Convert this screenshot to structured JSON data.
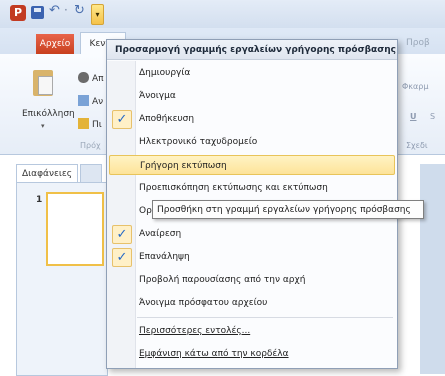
{
  "window": {
    "app_icon_letter": "P",
    "tabs": {
      "file": "Αρχείο",
      "home": "Κεντρ",
      "faint_right": "Προβ"
    },
    "ribbon": {
      "paste_label": "Επικόλληση",
      "small_cmds": [
        "Απ",
        "Αν",
        "Πι"
      ],
      "group_label": "Πρόχ",
      "right_snippets": [
        "Φκαρμ",
        "U",
        "S",
        "Σχεδι"
      ]
    },
    "pane": {
      "tab_slides": "Διαφάνειες",
      "slide_number": "1"
    }
  },
  "menu": {
    "title": "Προσαρμογή γραμμής εργαλείων γρήγορης πρόσβασης",
    "items": [
      {
        "label": "Δημιουργία",
        "checked": false,
        "highlighted": false
      },
      {
        "label": "Άνοιγμα",
        "checked": false,
        "highlighted": false
      },
      {
        "label": "Αποθήκευση",
        "checked": true,
        "highlighted": false
      },
      {
        "label": "Ηλεκτρονικό ταχυδρομείο",
        "checked": false,
        "highlighted": false
      },
      {
        "label": "Γρήγορη εκτύπωση",
        "checked": false,
        "highlighted": true
      },
      {
        "label": "Προεπισκόπηση εκτύπωσης και εκτύπωση",
        "checked": false,
        "highlighted": false
      },
      {
        "label": "Ορθ",
        "checked": false,
        "highlighted": false
      },
      {
        "label": "Αναίρεση",
        "checked": true,
        "highlighted": false
      },
      {
        "label": "Επανάληψη",
        "checked": true,
        "highlighted": false
      },
      {
        "label": "Προβολή παρουσίασης από την αρχή",
        "checked": false,
        "highlighted": false
      },
      {
        "label": "Άνοιγμα πρόσφατου αρχείου",
        "checked": false,
        "highlighted": false
      }
    ],
    "more_commands": "Περισσότερες εντολές...",
    "show_below": "Εμφάνιση κάτω από την κορδέλα"
  },
  "tooltip": "Προσθήκη στη γραμμή εργαλείων γρήγορης πρόσβασης",
  "check_glyph": "✓",
  "colors": {
    "file_tab": "#c8401f",
    "highlight": "#fde399",
    "check": "#2569c7"
  }
}
